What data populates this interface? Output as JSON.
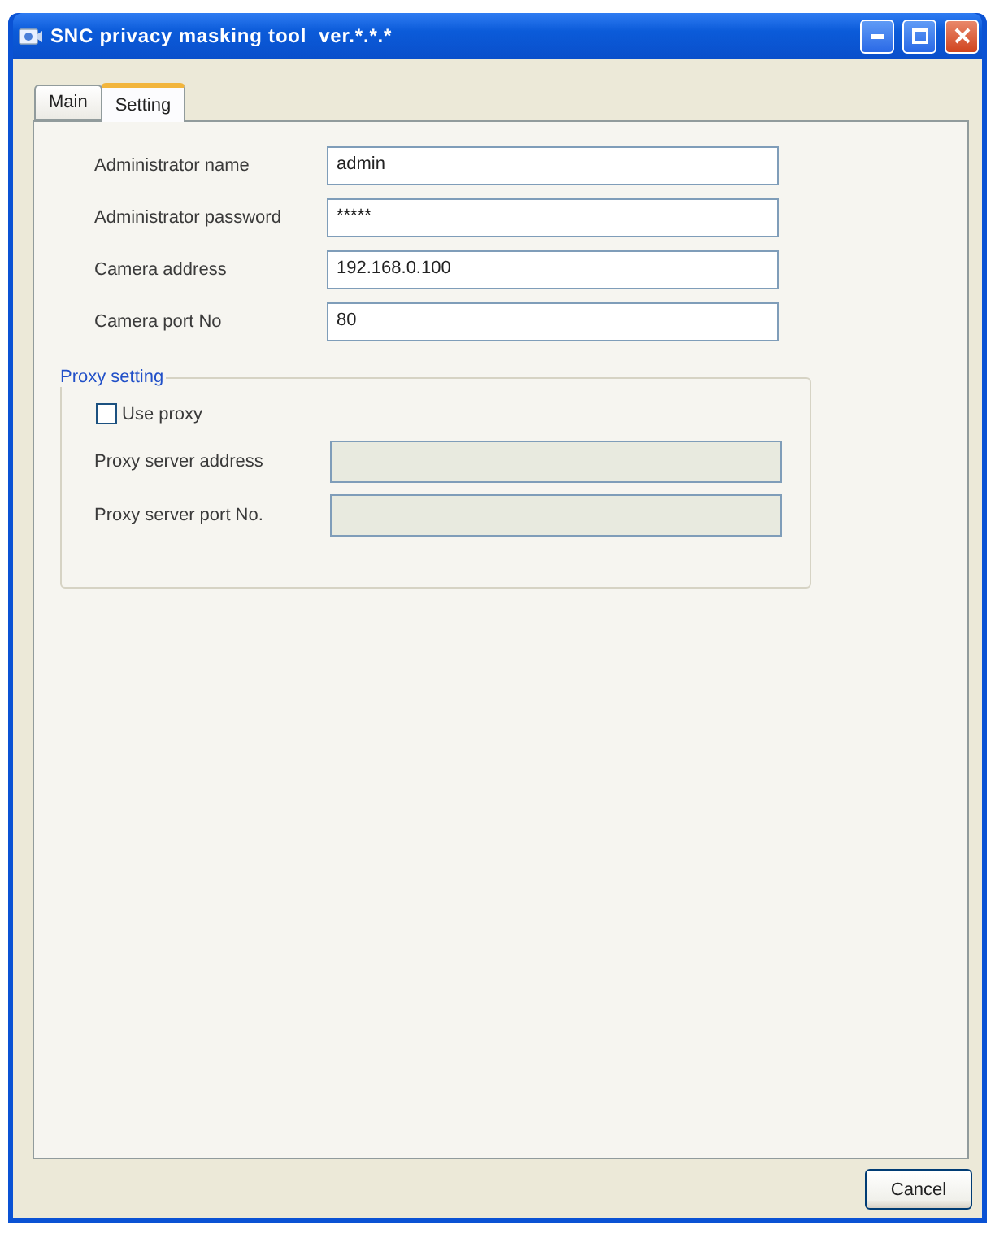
{
  "window": {
    "title": "SNC privacy masking tool  ver.*.*.*"
  },
  "tabs": [
    {
      "label": "Main",
      "selected": false
    },
    {
      "label": "Setting",
      "selected": true
    }
  ],
  "fields": [
    {
      "label": "Administrator name",
      "value": "admin"
    },
    {
      "label": "Administrator password",
      "value": "*****"
    },
    {
      "label": "Camera address",
      "value": "192.168.0.100"
    },
    {
      "label": "Camera port No",
      "value": "80"
    }
  ],
  "proxy_setting": {
    "legend": "Proxy setting",
    "use_proxy": {
      "label": "Use proxy",
      "checked": false
    },
    "fields": [
      {
        "label": "Proxy server address",
        "disabled": true
      },
      {
        "label": "Proxy server port No.",
        "disabled": true
      }
    ]
  },
  "buttons": [
    {
      "label": "Cancel"
    }
  ]
}
